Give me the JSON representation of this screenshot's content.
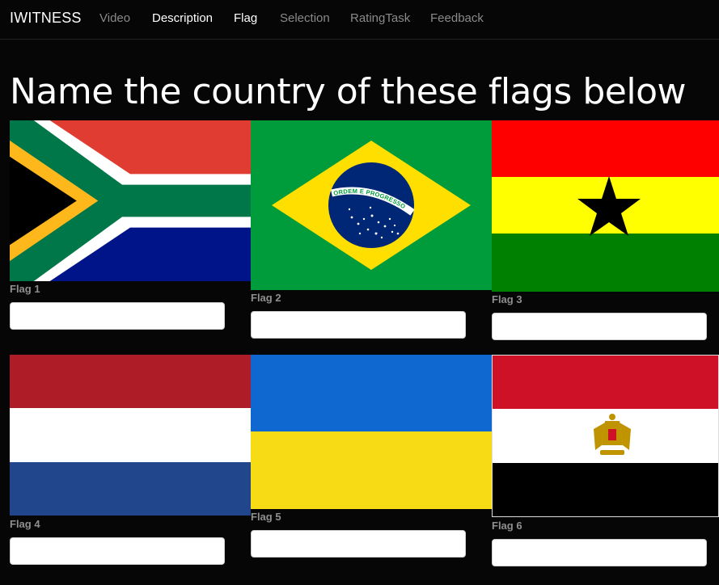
{
  "app": {
    "brand": "IWITNESS"
  },
  "nav": {
    "items": [
      {
        "label": "Video",
        "active": false
      },
      {
        "label": "Description",
        "active": true
      },
      {
        "label": "Flag",
        "active": true
      },
      {
        "label": "Selection",
        "active": false
      },
      {
        "label": "RatingTask",
        "active": false
      },
      {
        "label": "Feedback",
        "active": false
      }
    ]
  },
  "main": {
    "title": "Name the country of these flags below",
    "flags": [
      {
        "label": "Flag 1",
        "answer": ""
      },
      {
        "label": "Flag 2",
        "answer": ""
      },
      {
        "label": "Flag 3",
        "answer": ""
      },
      {
        "label": "Flag 4",
        "answer": ""
      },
      {
        "label": "Flag 5",
        "answer": ""
      },
      {
        "label": "Flag 6",
        "answer": ""
      }
    ],
    "flag2_motto": "ORDEM E PROGRESSO"
  },
  "colors": {
    "background": "#060606",
    "nav_inactive": "#8a8a8a",
    "nav_active": "#ffffff",
    "label": "#8f8f8f"
  }
}
